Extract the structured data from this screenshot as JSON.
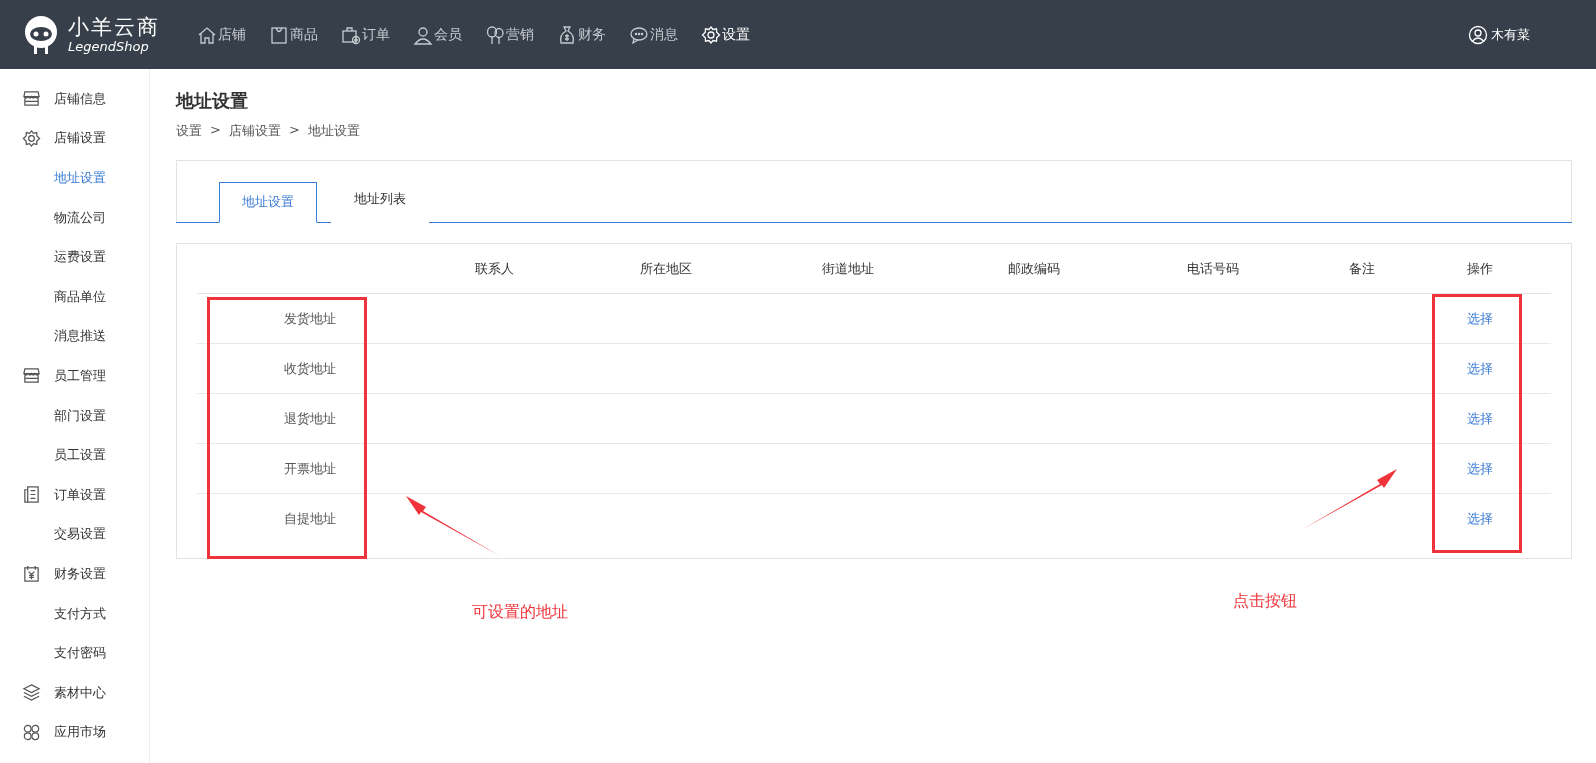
{
  "header": {
    "logo_title": "小羊云商",
    "logo_subtitle": "LegendShop",
    "nav": [
      {
        "label": "店铺",
        "selected": false
      },
      {
        "label": "商品",
        "selected": false
      },
      {
        "label": "订单",
        "selected": false
      },
      {
        "label": "会员",
        "selected": false
      },
      {
        "label": "营销",
        "selected": false
      },
      {
        "label": "财务",
        "selected": false
      },
      {
        "label": "消息",
        "selected": false
      },
      {
        "label": "设置",
        "selected": true
      }
    ],
    "user": "木有菜"
  },
  "sidebar": {
    "items": [
      {
        "label": "店铺信息",
        "kind": "group",
        "selected": false
      },
      {
        "label": "店铺设置",
        "kind": "group",
        "selected": false
      },
      {
        "label": "地址设置",
        "kind": "sub",
        "selected": true
      },
      {
        "label": "物流公司",
        "kind": "sub",
        "selected": false
      },
      {
        "label": "运费设置",
        "kind": "sub",
        "selected": false
      },
      {
        "label": "商品单位",
        "kind": "sub",
        "selected": false
      },
      {
        "label": "消息推送",
        "kind": "sub",
        "selected": false
      },
      {
        "label": "员工管理",
        "kind": "group",
        "selected": false
      },
      {
        "label": "部门设置",
        "kind": "sub",
        "selected": false
      },
      {
        "label": "员工设置",
        "kind": "sub",
        "selected": false
      },
      {
        "label": "订单设置",
        "kind": "group",
        "selected": false
      },
      {
        "label": "交易设置",
        "kind": "sub",
        "selected": false
      },
      {
        "label": "财务设置",
        "kind": "group",
        "selected": false
      },
      {
        "label": "支付方式",
        "kind": "sub",
        "selected": false
      },
      {
        "label": "支付密码",
        "kind": "sub",
        "selected": false
      },
      {
        "label": "素材中心",
        "kind": "group",
        "selected": false
      },
      {
        "label": "应用市场",
        "kind": "group",
        "selected": false
      }
    ]
  },
  "page": {
    "title": "地址设置",
    "breadcrumb": [
      {
        "label": "设置"
      },
      {
        "separator": ">",
        "label": "店铺设置"
      },
      {
        "separator": ">",
        "label": "地址设置"
      }
    ]
  },
  "tabs": [
    {
      "label": "地址设置",
      "selected": true
    },
    {
      "label": "地址列表",
      "selected": false
    }
  ],
  "table": {
    "columns": [
      "联系人",
      "所在地区",
      "街道地址",
      "邮政编码",
      "电话号码",
      "备注",
      "操作"
    ],
    "rows": [
      {
        "label": "发货地址",
        "action": "选择"
      },
      {
        "label": "收货地址",
        "action": "选择"
      },
      {
        "label": "退货地址",
        "action": "选择"
      },
      {
        "label": "开票地址",
        "action": "选择"
      },
      {
        "label": "自提地址",
        "action": "选择"
      }
    ]
  },
  "annotations": [
    {
      "text": "可设置的地址"
    },
    {
      "text": "点击按钮"
    }
  ]
}
